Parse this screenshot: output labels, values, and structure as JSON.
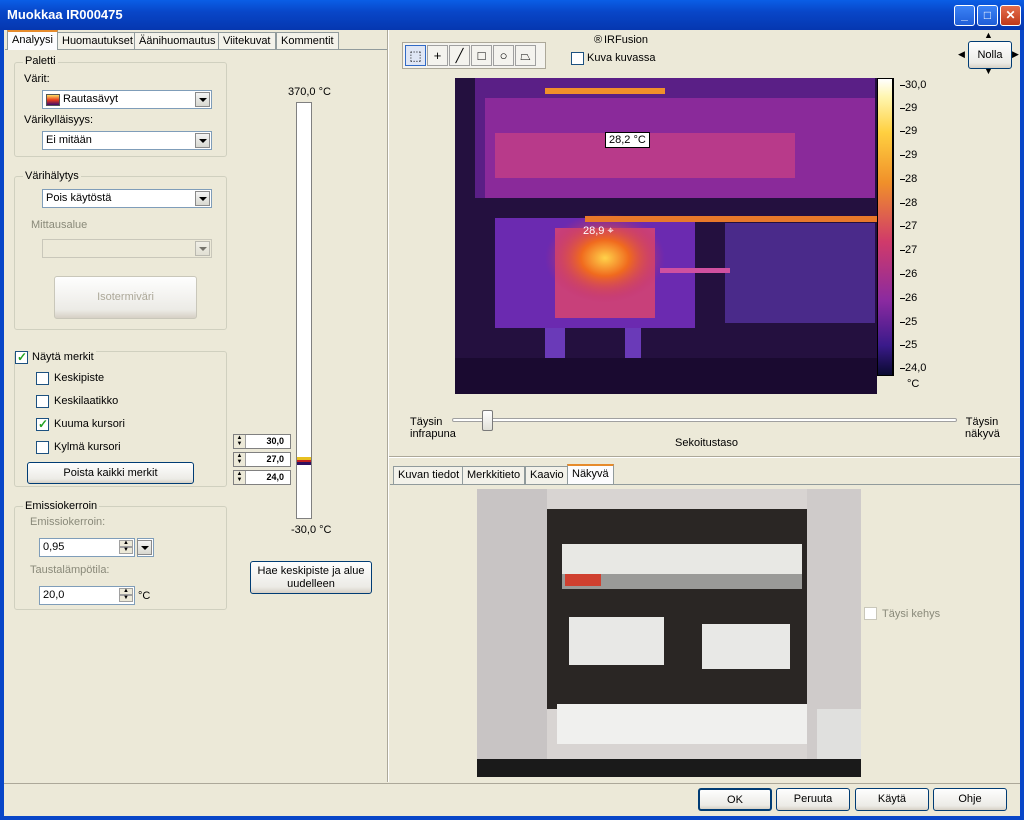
{
  "window": {
    "title": "Muokkaa IR000475"
  },
  "tabs_left": [
    "Analyysi",
    "Huomautukset",
    "Äänihuomautus",
    "Viitekuvat",
    "Kommentit"
  ],
  "palette": {
    "group_label": "Paletti",
    "colors_label": "Värit:",
    "colors_value": "Rautasävyt",
    "saturation_label": "Värikylläisyys:",
    "saturation_value": "Ei mitään"
  },
  "color_alarm": {
    "group_label": "Värihälytys",
    "value": "Pois käytöstä",
    "range_label": "Mittausalue",
    "isotherm_button": "Isotermiväri"
  },
  "markers": {
    "show_label": "Näytä merkit",
    "show_checked": true,
    "items": [
      {
        "label": "Keskipiste",
        "checked": false
      },
      {
        "label": "Keskilaatikko",
        "checked": false
      },
      {
        "label": "Kuuma kursori",
        "checked": true
      },
      {
        "label": "Kylmä kursori",
        "checked": false
      }
    ],
    "clear_button": "Poista kaikki merkit"
  },
  "emissivity": {
    "group_label": "Emissiokerroin",
    "emissivity_label": "Emissiokerroin:",
    "emissivity_value": "0,95",
    "bg_temp_label": "Taustalämpötila:",
    "bg_temp_value": "20,0",
    "bg_temp_unit": "°C"
  },
  "range_slider": {
    "top_label": "370,0 °C",
    "bottom_label": "-30,0 °C",
    "spin_values": [
      "30,0",
      "27,0",
      "24,0"
    ],
    "refresh_button": "Hae keskipiste ja alue uudelleen"
  },
  "toolbar": {
    "irfusion_label": "IRFusion",
    "picture_in_picture_label": "Kuva kuvassa",
    "reset_label": "Nolla"
  },
  "ir_image": {
    "marker1": "28,2 °C",
    "marker2": "28,9",
    "scale_labels": [
      "30,0",
      "29",
      "29",
      "29",
      "28",
      "28",
      "27",
      "27",
      "26",
      "26",
      "25",
      "25",
      "24,0"
    ],
    "scale_unit": "°C"
  },
  "blend": {
    "left_label": "Täysin infrapuna",
    "right_label": "Täysin näkyvä",
    "center_label": "Sekoitustaso",
    "level": 0.06
  },
  "tabs_bottom": [
    "Kuvan tiedot",
    "Merkkitieto",
    "Kaavio",
    "Näkyvä"
  ],
  "visible": {
    "full_frame_label": "Täysi kehys"
  },
  "footer": {
    "ok": "OK",
    "cancel": "Peruuta",
    "apply": "Käytä",
    "help": "Ohje"
  },
  "colors": {
    "titlebar": "#0846c8",
    "dialog": "#ece9d8",
    "tab_accent": "#e68b2c"
  }
}
